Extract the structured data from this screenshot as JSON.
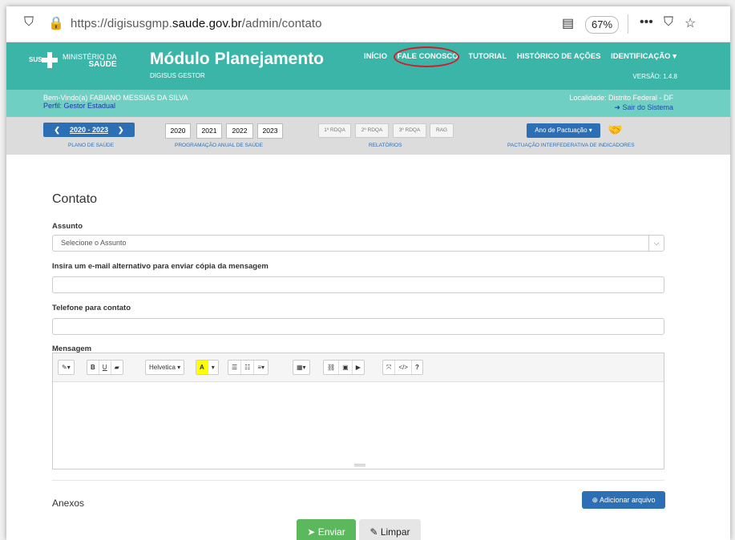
{
  "browser": {
    "url_prefix": "https://digisusgmp.",
    "url_domain": "saude.gov.br",
    "url_path": "/admin/contato",
    "zoom": "67%"
  },
  "header": {
    "sus": "SUS",
    "ministerio": "MINISTÉRIO DA",
    "saude": "SAÚDE",
    "title": "Módulo Planejamento",
    "subtitle": "DIGISUS GESTOR",
    "nav": [
      "INÍCIO",
      "FALE CONOSCO",
      "TUTORIAL",
      "HISTÓRICO DE AÇÕES",
      "IDENTIFICAÇÃO ▾"
    ],
    "version": "VERSÃO: 1.4.8"
  },
  "welcome": {
    "greeting": "Bem-Vindo(a) FABIANO MESSIAS DA SILVA",
    "profile": "Perfil: Gestor Estadual",
    "location": "Localidade: Distrito Federal - DF",
    "logout": "➜ Sair do Sistema"
  },
  "toolbar": {
    "plano_period": "2020 - 2023",
    "plano_label": "PLANO DE SAÚDE",
    "years": [
      "2020",
      "2021",
      "2022",
      "2023"
    ],
    "years_label": "PROGRAMAÇÃO ANUAL DE SAÚDE",
    "reports": [
      "1º RDQA",
      "2º RDQA",
      "3º RDQA",
      "RAG"
    ],
    "reports_label": "RELATÓRIOS",
    "pactuacao_button": "Ano de Pactuação ▾",
    "pactuacao_label": "PACTUAÇÃO INTERFEDERATIVA DE INDICADORES"
  },
  "form": {
    "title": "Contato",
    "assunto_label": "Assunto",
    "assunto_value": "Selecione o Assunto",
    "email_label": "Insira um e-mail alternativo para enviar cópia da mensagem",
    "email_value": "",
    "phone_label": "Telefone para contato",
    "phone_value": "",
    "message_label": "Mensagem",
    "font_name": "Helvetica ▾",
    "anexos_label": "Anexos",
    "add_file": "Adicionar arquivo",
    "send": "Enviar",
    "clear": "Limpar"
  }
}
